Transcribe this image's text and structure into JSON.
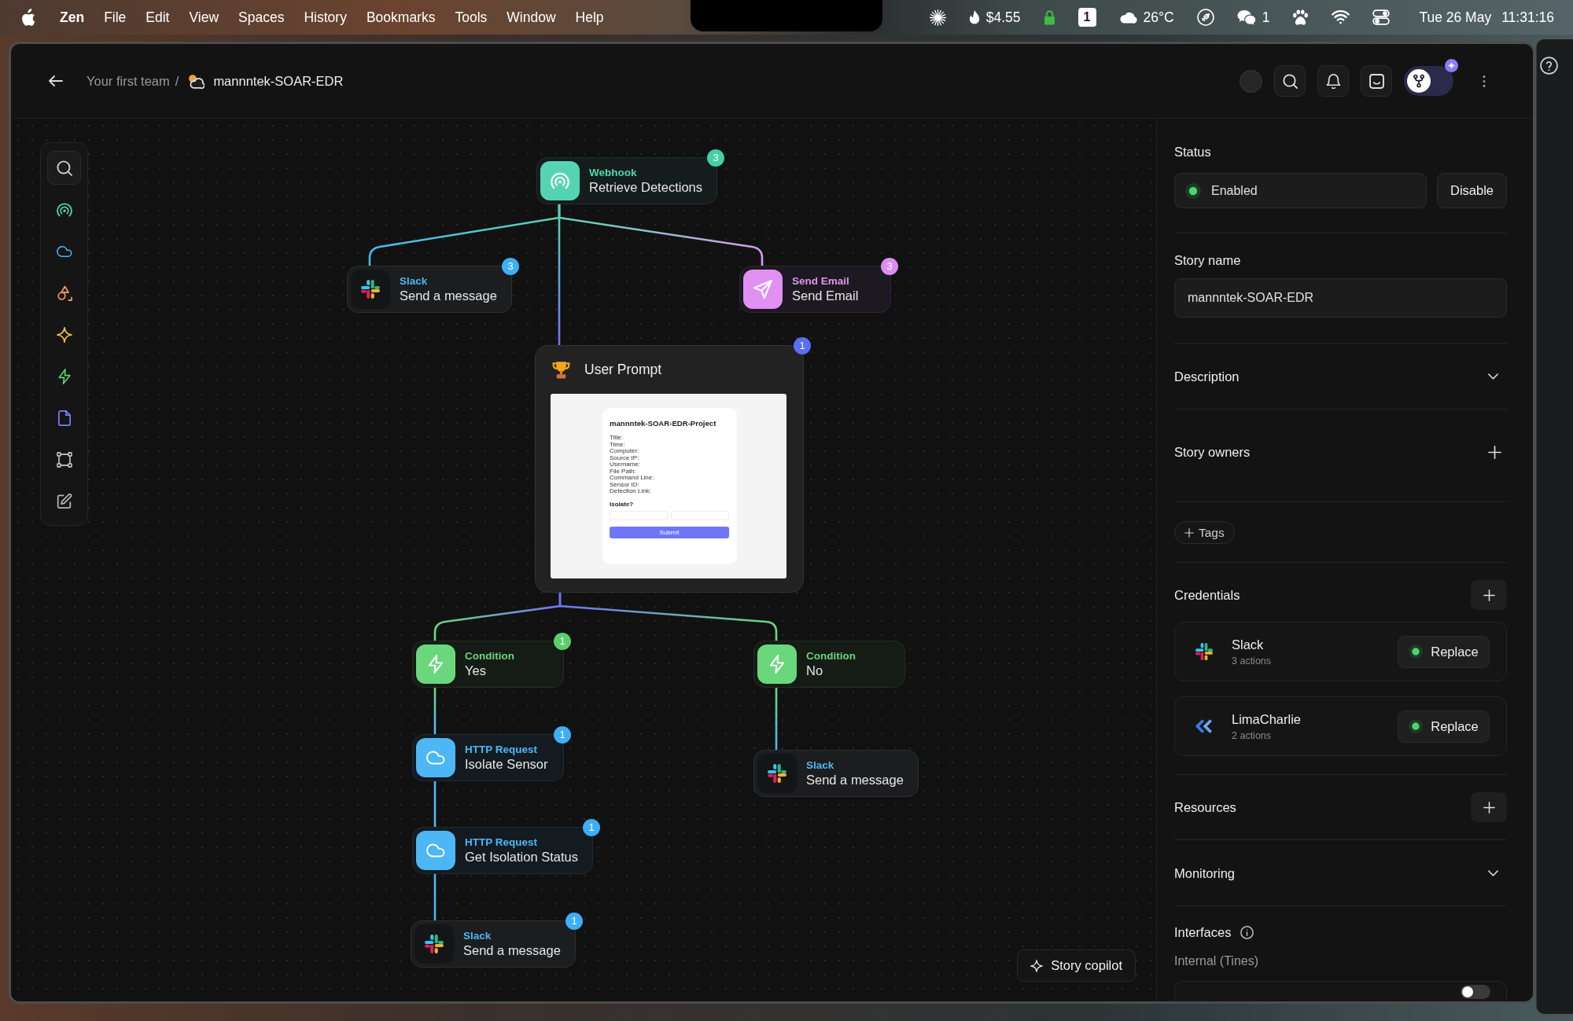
{
  "menu_bar": {
    "app_name": "Zen",
    "menus": [
      "File",
      "Edit",
      "View",
      "Spaces",
      "History",
      "Bookmarks",
      "Tools",
      "Window",
      "Help"
    ],
    "status_items": [
      {
        "kind": "sparkle"
      },
      {
        "kind": "flame",
        "text": "$4.55"
      },
      {
        "kind": "lock"
      },
      {
        "kind": "counter",
        "text": "1"
      },
      {
        "kind": "weather",
        "text": "26°C"
      },
      {
        "kind": "rocket"
      },
      {
        "kind": "chat",
        "text": "1"
      },
      {
        "kind": "paw"
      },
      {
        "kind": "wifi"
      },
      {
        "kind": "controls"
      }
    ],
    "date": "Tue 26 May",
    "time": "11:31:16"
  },
  "header": {
    "team": "Your first team",
    "separator": "/",
    "story": "mannntek-SOAR-EDR",
    "mode_switch": {
      "on": false
    }
  },
  "canvas": {
    "nodes": [
      {
        "kind": "webhook",
        "type": "Webhook",
        "name": "Retrieve Detections",
        "badge": "3",
        "children": [
          {
            "kind": "slack",
            "type": "Slack",
            "name": "Send a message",
            "badge": "3"
          },
          {
            "kind": "email",
            "type": "Send Email",
            "name": "Send Email",
            "badge": "3"
          },
          {
            "kind": "prompt",
            "name": "User Prompt",
            "badge": "1",
            "preview": {
              "title": "mannntek-SOAR-EDR-Project",
              "fields": [
                "Title:",
                "Time:",
                "Computer:",
                "Source IP:",
                "Username:",
                "File Path:",
                "Command Line:",
                "Sensor ID:",
                "Detection Link:"
              ],
              "question": "Isolate?",
              "button": "Submit"
            },
            "children": [
              {
                "kind": "condition",
                "type": "Condition",
                "name": "Yes",
                "badge": "1",
                "children": [
                  {
                    "kind": "http",
                    "type": "HTTP Request",
                    "name": "Isolate Sensor",
                    "badge": "1",
                    "children": [
                      {
                        "kind": "http",
                        "type": "HTTP Request",
                        "name": "Get Isolation Status",
                        "badge": "1",
                        "children": [
                          {
                            "kind": "slack",
                            "type": "Slack",
                            "name": "Send a message",
                            "badge": "1"
                          }
                        ]
                      }
                    ]
                  }
                ]
              },
              {
                "kind": "condition",
                "type": "Condition",
                "name": "No",
                "children": [
                  {
                    "kind": "slack",
                    "type": "Slack",
                    "name": "Send a message"
                  }
                ]
              }
            ]
          }
        ]
      }
    ],
    "copilot_button": "Story copilot"
  },
  "settings_panel": {
    "status": {
      "label": "Status",
      "value": "Enabled",
      "on": true,
      "button": "Disable"
    },
    "story_name": {
      "label": "Story name",
      "value": "mannntek-SOAR-EDR"
    },
    "sections": [
      {
        "kind": "collapsible",
        "title": "Description",
        "expanded": false
      },
      {
        "kind": "owners",
        "title": "Story owners"
      },
      {
        "kind": "tags",
        "button": "Tags"
      },
      {
        "kind": "credentials",
        "title": "Credentials",
        "items": [
          {
            "kind": "slack",
            "name": "Slack",
            "detail": "3 actions",
            "connected": true,
            "button": "Replace"
          },
          {
            "kind": "limacharlie",
            "name": "LimaCharlie",
            "detail": "2 actions",
            "connected": true,
            "button": "Replace"
          }
        ]
      },
      {
        "kind": "resources",
        "title": "Resources"
      },
      {
        "kind": "collapsible",
        "title": "Monitoring",
        "expanded": false
      },
      {
        "kind": "interfaces",
        "title": "Interfaces",
        "subtitle": "Internal (Tines)",
        "items": [
          {
            "on": false
          }
        ]
      }
    ]
  }
}
